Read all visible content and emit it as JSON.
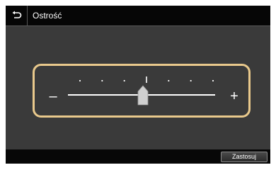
{
  "header": {
    "title": "Ostrość"
  },
  "slider": {
    "min_label": "–",
    "max_label": "+",
    "tick_count": 7,
    "value_index": 3,
    "marked_tick_index": 3
  },
  "footer": {
    "apply_label": "Zastosuj"
  },
  "icons": {
    "back": "back-arrow-icon"
  }
}
